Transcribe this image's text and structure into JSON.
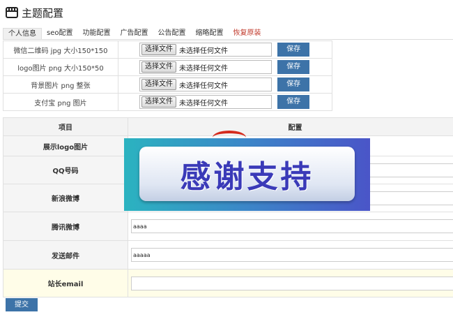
{
  "header": {
    "title": "主题配置",
    "icon": "window-icon"
  },
  "tabs": [
    {
      "label": "个人信息",
      "active": true
    },
    {
      "label": "seo配置"
    },
    {
      "label": "功能配置"
    },
    {
      "label": "广告配置"
    },
    {
      "label": "公告配置"
    },
    {
      "label": "缩略配置"
    },
    {
      "label": "恢复原装",
      "color": "#c0392b"
    }
  ],
  "uploads": [
    {
      "label": "微信二维码 jpg 大小150*150",
      "button": "选择文件",
      "status": "未选择任何文件",
      "save": "保存"
    },
    {
      "label": "logo图片 png 大小150*50",
      "button": "选择文件",
      "status": "未选择任何文件",
      "save": "保存"
    },
    {
      "label": "背景图片 png 整张",
      "button": "选择文件",
      "status": "未选择任何文件",
      "save": "保存"
    },
    {
      "label": "支付宝 png 图片",
      "button": "选择文件",
      "status": "未选择任何文件",
      "save": "保存"
    }
  ],
  "config": {
    "headers": {
      "item": "项目",
      "setting": "配置"
    },
    "rows": [
      {
        "label": "展示logo图片",
        "value": ""
      },
      {
        "label": "QQ号码",
        "value": ""
      },
      {
        "label": "新浪微博",
        "value": ""
      },
      {
        "label": "腾讯微博",
        "value": "aaaa"
      },
      {
        "label": "发送邮件",
        "value": "aaaaa"
      },
      {
        "label": "站长email",
        "value": ""
      }
    ]
  },
  "submit": {
    "label": "提交"
  },
  "overlay": {
    "text": "感谢支持"
  },
  "colors": {
    "primary_button": "#3d73a8",
    "danger_tab": "#c0392b",
    "highlight_row": "#fffde8"
  }
}
